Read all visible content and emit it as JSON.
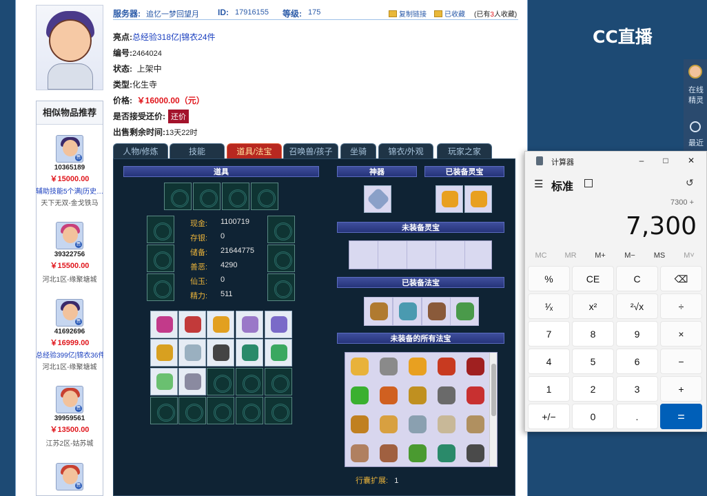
{
  "topbar": {
    "server_label": "服务器:",
    "server_value": "追忆一梦回望月",
    "id_label": "ID:",
    "id_value": "17916155",
    "level_label": "等级:",
    "level_value": "175",
    "copy_link": "复制链接",
    "favorited": "已收藏",
    "favorite_count_prefix": "(已有",
    "favorite_count": "3",
    "favorite_count_suffix": "人收藏)"
  },
  "info": {
    "highlight_label": "亮点:",
    "highlight_value": "总经验318亿|锦衣24件",
    "number_label": "编号:",
    "number_value": "2464024",
    "status_label": "状态:",
    "status_value": "上架中",
    "type_label": "类型:",
    "type_value": "化生寺",
    "price_label": "价格:",
    "price_value": "￥16000.00（元）",
    "counter_label": "是否接受还价:",
    "counter_button": "还价",
    "time_label": "出售剩余时间:",
    "time_value": "13天22时"
  },
  "similar": {
    "title": "相似物品推荐",
    "items": [
      {
        "id": "10365189",
        "price": "￥15000.00",
        "highlight": "辅助技能5个满|历史…",
        "server": "天下无双-金戈铁马",
        "hair": "#3a2a6a"
      },
      {
        "id": "39322756",
        "price": "￥15500.00",
        "highlight": "",
        "server": "河北1区-缘聚塘城",
        "hair": "#c8407a"
      },
      {
        "id": "41692696",
        "price": "￥16999.00",
        "highlight": "总经验399亿|锦衣36件",
        "server": "河北1区-缘聚塘城",
        "hair": "#3a2a6a"
      },
      {
        "id": "39959561",
        "price": "￥13500.00",
        "highlight": "",
        "server": "江苏2区-姑苏城",
        "hair": "#c84030"
      },
      {
        "id": "",
        "price": "",
        "highlight": "",
        "server": "",
        "hair": "#c84030"
      }
    ]
  },
  "tabs": [
    "人物/修炼",
    "技能",
    "道具/法宝",
    "召唤兽/孩子",
    "坐骑",
    "锦衣/外观",
    "玩家之家"
  ],
  "active_tab": "道具/法宝",
  "panel": {
    "items_header": "道具",
    "artifact_header": "神器",
    "equipped_lingbao_header": "已装备灵宝",
    "unequipped_lingbao_header": "未装备灵宝",
    "equipped_fabao_header": "已装备法宝",
    "all_fabao_header": "未装备的所有法宝",
    "bag_ext_label": "行囊扩展:",
    "bag_ext_value": "1",
    "stats": [
      {
        "label": "现金:",
        "value": "1100719"
      },
      {
        "label": "存银:",
        "value": "0"
      },
      {
        "label": "储备:",
        "value": "21644775"
      },
      {
        "label": "善恶:",
        "value": "4290"
      },
      {
        "label": "仙玉:",
        "value": "0"
      },
      {
        "label": "精力:",
        "value": "511"
      }
    ]
  },
  "colors": {
    "equip_items": [
      "#c23a8a",
      "#c23a3a",
      "#e2a020",
      "#9a78c8",
      "#7a6ac8",
      "#d8a020",
      "#9ab0c0",
      "#444444",
      "#2a8a6a",
      "#3aa860",
      "#6ac070",
      "#8a8aa0"
    ],
    "fabao": [
      "#b07a30",
      "#4a9ab0",
      "#8a5a3a",
      "#4a9a4a"
    ],
    "bag": [
      "#e8b23a",
      "#8a8a8a",
      "#e8a020",
      "#c83a20",
      "#a02020",
      "#3ab030",
      "#d06020",
      "#c09020",
      "#6a6a6a",
      "#c83030",
      "#c08020",
      "#d8a040",
      "#8aa0b0",
      "#c8b898",
      "#b09060",
      "#b08060",
      "#a06040",
      "#4a9a30",
      "#2a8a6a",
      "#4a4a4a"
    ]
  },
  "calculator": {
    "title": "计算器",
    "mode": "标准",
    "expression": "7300 +",
    "display": "7,300",
    "memory": [
      "MC",
      "MR",
      "M+",
      "M−",
      "MS",
      "M˅"
    ],
    "keys": [
      [
        "%",
        "CE",
        "C",
        "⌫"
      ],
      [
        "¹⁄ₓ",
        "x²",
        "²√x",
        "÷"
      ],
      [
        "7",
        "8",
        "9",
        "×"
      ],
      [
        "4",
        "5",
        "6",
        "−"
      ],
      [
        "1",
        "2",
        "3",
        "+"
      ],
      [
        "+/−",
        "0",
        ".",
        "="
      ]
    ]
  },
  "live": {
    "logo": "CC直播",
    "side_1": "在线精灵",
    "side_2": "最近"
  }
}
